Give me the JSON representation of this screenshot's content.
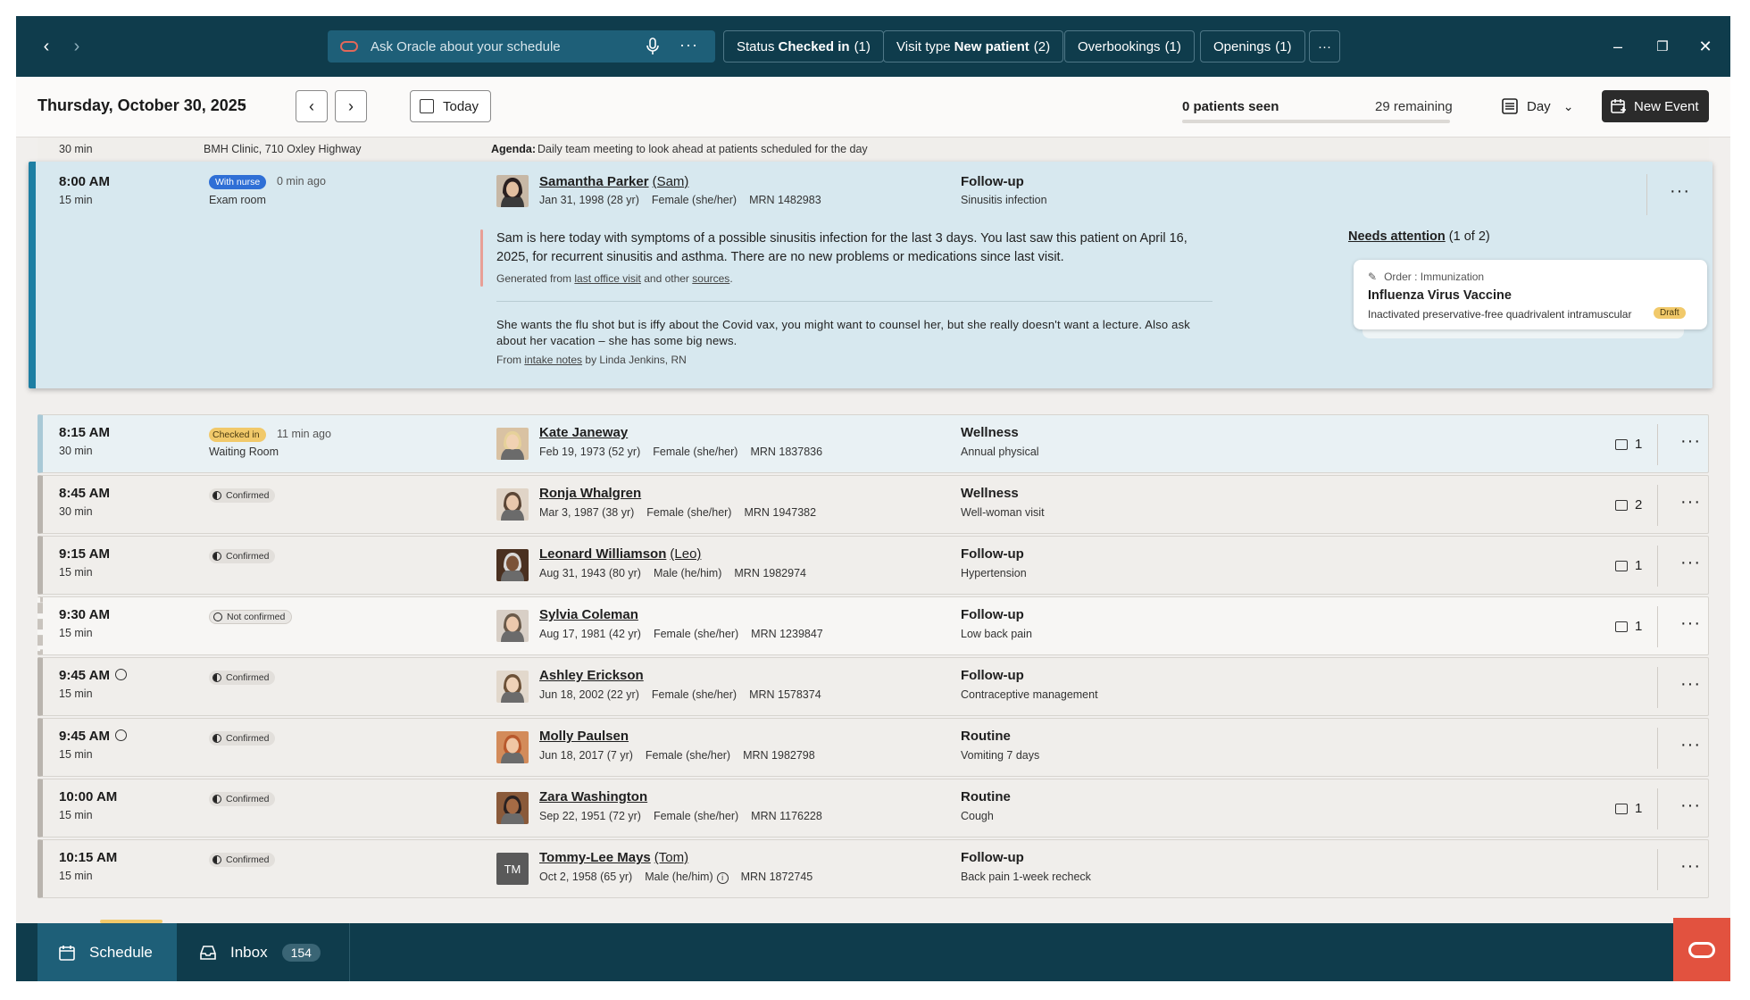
{
  "top": {
    "ask_placeholder": "Ask Oracle about your schedule",
    "chips": [
      {
        "label": "Status",
        "value": "Checked in",
        "count": "(1)"
      },
      {
        "label": "Visit type",
        "value": "New patient",
        "count": "(2)"
      },
      {
        "label": "Overbookings",
        "value": "",
        "count": "(1)"
      },
      {
        "label": "Openings",
        "value": "",
        "count": "(1)"
      }
    ]
  },
  "header": {
    "date": "Thursday, October 30, 2025",
    "today": "Today",
    "seen": "0 patients seen",
    "remaining": "29 remaining",
    "progress_fraction": 0,
    "view": "Day",
    "new_event": "New Event"
  },
  "partial_row": {
    "duration": "30 min",
    "location": "BMH Clinic, 710 Oxley Highway",
    "agenda_label": "Agenda:",
    "agenda": "Daily team meeting to look ahead at patients scheduled for the day"
  },
  "expanded": {
    "time": "8:00 AM",
    "duration": "15 min",
    "badge": "With nurse",
    "ago": "0 min ago",
    "location": "Exam room",
    "name": "Samantha Parker",
    "nick": "(Sam)",
    "dob": "Jan 31, 1998 (28 yr)",
    "sex": "Female (she/her)",
    "mrn": "MRN 1482983",
    "visit_type": "Follow-up",
    "reason": "Sinusitis infection",
    "summary": "Sam is here today with symptoms of a possible sinusitis infection for the last 3 days. You last saw this patient on April 16, 2025, for recurrent sinusitis and asthma. There are no new problems or medications since last visit.",
    "gen_prefix": "Generated from",
    "gen_link1": "last office visit",
    "gen_mid": "and other",
    "gen_link2": "sources",
    "gen_suffix": ".",
    "note": "She wants the flu shot but is iffy about the Covid vax, you might want to counsel her, but she really doesn't want a lecture. Also ask about her vacation – she has some big news.",
    "from_prefix": "From",
    "from_link": "intake notes",
    "from_suffix": "by Linda Jenkins, RN",
    "needs_label": "Needs attention",
    "needs_count": "(1 of 2)",
    "card": {
      "type": "Order : Immunization",
      "title": "Influenza Virus Vaccine",
      "desc": "Inactivated preservative-free quadrivalent intramuscular",
      "status": "Draft"
    }
  },
  "rows": [
    {
      "time": "8:15 AM",
      "duration": "30 min",
      "status": "Checked in",
      "ago": "11 min ago",
      "location": "Waiting Room",
      "name": "Kate Janeway",
      "nick": "",
      "dob": "Feb 19, 1973 (52 yr)",
      "sex": "Female (she/her)",
      "mrn": "MRN 1837836",
      "visit_type": "Wellness",
      "reason": "Annual physical",
      "messages": "1"
    },
    {
      "time": "8:45 AM",
      "duration": "30 min",
      "status": "Confirmed",
      "ago": "",
      "location": "",
      "name": "Ronja Whalgren",
      "nick": "",
      "dob": "Mar 3, 1987 (38 yr)",
      "sex": "Female (she/her)",
      "mrn": "MRN 1947382",
      "visit_type": "Wellness",
      "reason": "Well-woman visit",
      "messages": "2"
    },
    {
      "time": "9:15 AM",
      "duration": "15 min",
      "status": "Confirmed",
      "ago": "",
      "location": "",
      "name": "Leonard Williamson",
      "nick": "(Leo)",
      "dob": "Aug 31, 1943 (80 yr)",
      "sex": "Male (he/him)",
      "mrn": "MRN 1982974",
      "visit_type": "Follow-up",
      "reason": "Hypertension",
      "messages": "1"
    },
    {
      "time": "9:30 AM",
      "duration": "15 min",
      "status": "Not confirmed",
      "ago": "",
      "location": "",
      "name": "Sylvia Coleman",
      "nick": "",
      "dob": "Aug 17, 1981 (42 yr)",
      "sex": "Female (she/her)",
      "mrn": "MRN 1239847",
      "visit_type": "Follow-up",
      "reason": "Low back pain",
      "messages": "1"
    },
    {
      "time": "9:45 AM",
      "duration": "15 min",
      "status": "Confirmed",
      "ago": "",
      "location": "",
      "name": "Ashley Erickson",
      "nick": "",
      "dob": "Jun 18, 2002 (22 yr)",
      "sex": "Female (she/her)",
      "mrn": "MRN 1578374",
      "visit_type": "Follow-up",
      "reason": "Contraceptive management",
      "messages": ""
    },
    {
      "time": "9:45 AM",
      "duration": "15 min",
      "status": "Confirmed",
      "ago": "",
      "location": "",
      "name": "Molly Paulsen",
      "nick": "",
      "dob": "Jun 18, 2017 (7 yr)",
      "sex": "Female (she/her)",
      "mrn": "MRN 1982798",
      "visit_type": "Routine",
      "reason": "Vomiting 7 days",
      "messages": ""
    },
    {
      "time": "10:00 AM",
      "duration": "15 min",
      "status": "Confirmed",
      "ago": "",
      "location": "",
      "name": "Zara Washington",
      "nick": "",
      "dob": "Sep 22, 1951 (72 yr)",
      "sex": "Female (she/her)",
      "mrn": "MRN 1176228",
      "visit_type": "Routine",
      "reason": "Cough",
      "messages": "1"
    },
    {
      "time": "10:15 AM",
      "duration": "15 min",
      "status": "Confirmed",
      "ago": "",
      "location": "",
      "name": "Tommy-Lee Mays",
      "nick": "(Tom)",
      "initials": "TM",
      "dob": "Oct 2, 1958 (65 yr)",
      "sex": "Male (he/him)",
      "mrn": "MRN 1872745",
      "visit_type": "Follow-up",
      "reason": "Back pain 1-week recheck",
      "messages": ""
    }
  ],
  "bottom": {
    "schedule": "Schedule",
    "inbox": "Inbox",
    "inbox_count": "154"
  },
  "colors": {
    "topbar": "#0f3c4c",
    "accent": "#1d7fa3",
    "oracle_red": "#e2523f",
    "checked_in": "#f1c96a",
    "with_nurse": "#2f6fd6"
  }
}
